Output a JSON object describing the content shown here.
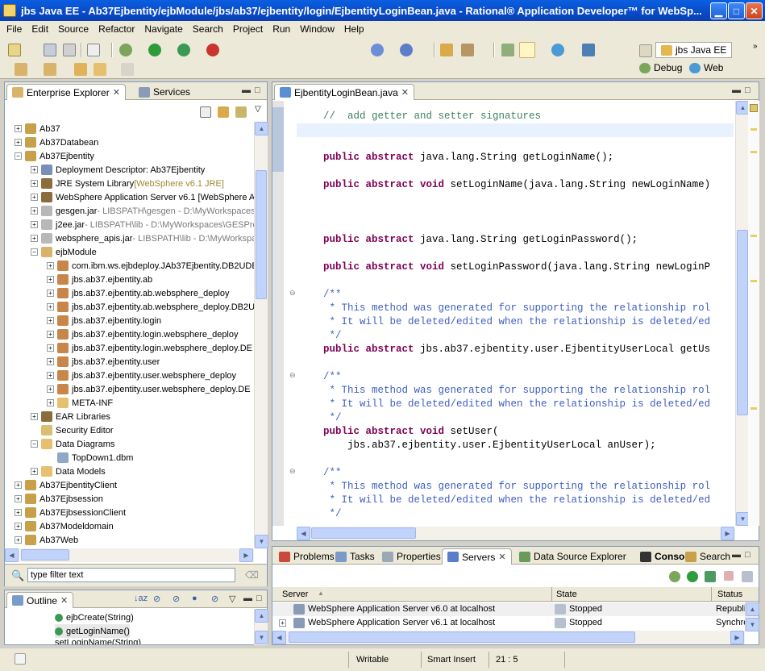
{
  "window": {
    "title": "jbs Java EE - Ab37Ejbentity/ejbModule/jbs/ab37/ejbentity/login/EjbentityLoginBean.java - Rational® Application Developer™ for WebSp..."
  },
  "menu": [
    "File",
    "Edit",
    "Source",
    "Refactor",
    "Navigate",
    "Search",
    "Project",
    "Run",
    "Window",
    "Help"
  ],
  "perspectives": {
    "current": "jbs Java EE",
    "debug": "Debug",
    "web": "Web"
  },
  "explorer": {
    "tabs": [
      {
        "label": "Enterprise Explorer"
      },
      {
        "label": "Services"
      }
    ],
    "rows": [
      {
        "label": "Ab37",
        "deco": ""
      },
      {
        "label": "Ab37Databean",
        "deco": ""
      },
      {
        "label": "Ab37Ejbentity",
        "deco": ""
      },
      {
        "label": "Deployment Descriptor: Ab37Ejbentity",
        "deco": ""
      },
      {
        "label": "JRE System Library ",
        "deco": "[WebSphere v6.1 JRE]"
      },
      {
        "label": "WebSphere Application Server v6.1 [WebSphere A",
        "deco": ""
      },
      {
        "label": "gesgen.jar",
        "deco": " - LIBSPATH\\gesgen - D:\\MyWorkspaces"
      },
      {
        "label": "j2ee.jar",
        "deco": " - LIBSPATH\\lib - D:\\MyWorkspaces\\GESPro"
      },
      {
        "label": "websphere_apis.jar",
        "deco": " - LIBSPATH\\lib - D:\\MyWorkspa"
      },
      {
        "label": "ejbModule",
        "deco": ""
      },
      {
        "label": "com.ibm.ws.ejbdeploy.JAb37Ejbentity.DB2UDE",
        "deco": ""
      },
      {
        "label": "jbs.ab37.ejbentity.ab",
        "deco": ""
      },
      {
        "label": "jbs.ab37.ejbentity.ab.websphere_deploy",
        "deco": ""
      },
      {
        "label": "jbs.ab37.ejbentity.ab.websphere_deploy.DB2U",
        "deco": ""
      },
      {
        "label": "jbs.ab37.ejbentity.login",
        "deco": ""
      },
      {
        "label": "jbs.ab37.ejbentity.login.websphere_deploy",
        "deco": ""
      },
      {
        "label": "jbs.ab37.ejbentity.login.websphere_deploy.DE",
        "deco": ""
      },
      {
        "label": "jbs.ab37.ejbentity.user",
        "deco": ""
      },
      {
        "label": "jbs.ab37.ejbentity.user.websphere_deploy",
        "deco": ""
      },
      {
        "label": "jbs.ab37.ejbentity.user.websphere_deploy.DE",
        "deco": ""
      },
      {
        "label": "META-INF",
        "deco": ""
      },
      {
        "label": "EAR Libraries",
        "deco": ""
      },
      {
        "label": "Security Editor",
        "deco": ""
      },
      {
        "label": "Data Diagrams",
        "deco": ""
      },
      {
        "label": "TopDown1.dbm",
        "deco": ""
      },
      {
        "label": "Data Models",
        "deco": ""
      },
      {
        "label": "Ab37EjbentityClient",
        "deco": ""
      },
      {
        "label": "Ab37Ejbsession",
        "deco": ""
      },
      {
        "label": "Ab37EjbsessionClient",
        "deco": ""
      },
      {
        "label": "Ab37Modeldomain",
        "deco": ""
      },
      {
        "label": "Ab37Web",
        "deco": ""
      }
    ],
    "filter_value": "type filter text"
  },
  "outline": {
    "tab": "Outline",
    "items": [
      {
        "label": "ejbCreate(String)"
      },
      {
        "label": "getLoginName()"
      },
      {
        "label": "setLoginName(String)"
      }
    ]
  },
  "editor": {
    "tab": "EjbentityLoginBean.java",
    "lines": [
      {
        "kind": "comment",
        "text": "//  add getter and setter signatures"
      },
      {
        "kind": "code",
        "kw": "public abstract",
        "rest": " java.lang.String getLoginName();"
      },
      {
        "kind": "code",
        "kw": "public abstract void",
        "rest": " setLoginName(java.lang.String newLoginName)"
      },
      {
        "kind": "code",
        "kw": "public abstract",
        "rest": " java.lang.String getLoginPassword();"
      },
      {
        "kind": "code",
        "kw": "public abstract void",
        "rest": " setLoginPassword(java.lang.String newLoginP"
      },
      {
        "kind": "doc",
        "text": "/**"
      },
      {
        "kind": "doc",
        "text": " * This method was generated for supporting the relationship rol"
      },
      {
        "kind": "doc",
        "text": " * It will be deleted/edited when the relationship is deleted/ed"
      },
      {
        "kind": "doc",
        "text": " */"
      },
      {
        "kind": "code",
        "kw": "public abstract",
        "rest": " jbs.ab37.ejbentity.user.EjbentityUserLocal getUs"
      },
      {
        "kind": "doc",
        "text": "/**"
      },
      {
        "kind": "doc",
        "text": " * This method was generated for supporting the relationship rol"
      },
      {
        "kind": "doc",
        "text": " * It will be deleted/edited when the relationship is deleted/ed"
      },
      {
        "kind": "doc",
        "text": " */"
      },
      {
        "kind": "code",
        "kw": "public abstract void",
        "rest": " setUser("
      },
      {
        "kind": "plain",
        "text": "    jbs.ab37.ejbentity.user.EjbentityUserLocal anUser);"
      },
      {
        "kind": "doc",
        "text": "/**"
      },
      {
        "kind": "doc",
        "text": " * This method was generated for supporting the relationship rol"
      },
      {
        "kind": "doc",
        "text": " * It will be deleted/edited when the relationship is deleted/ed"
      },
      {
        "kind": "doc",
        "text": " */"
      }
    ]
  },
  "bottom": {
    "tabs": [
      "Problems",
      "Tasks",
      "Properties",
      "Servers",
      "Data Source Explorer",
      "Console",
      "Search"
    ],
    "columns": [
      "Server",
      "State",
      "Status"
    ],
    "rows": [
      {
        "server": "WebSphere Application Server v6.0 at localhost",
        "state": "Stopped",
        "status": "Republi"
      },
      {
        "server": "WebSphere Application Server v6.1 at localhost",
        "state": "Stopped",
        "status": "Synchro"
      }
    ]
  },
  "status": {
    "mode": "Writable",
    "insert": "Smart Insert",
    "position": "21 : 5"
  },
  "colors": {
    "keyword": "#7f0055",
    "comment": "#3f7f5f",
    "javadoc": "#3f5fbf",
    "titlebar": "#0a4ac8"
  }
}
